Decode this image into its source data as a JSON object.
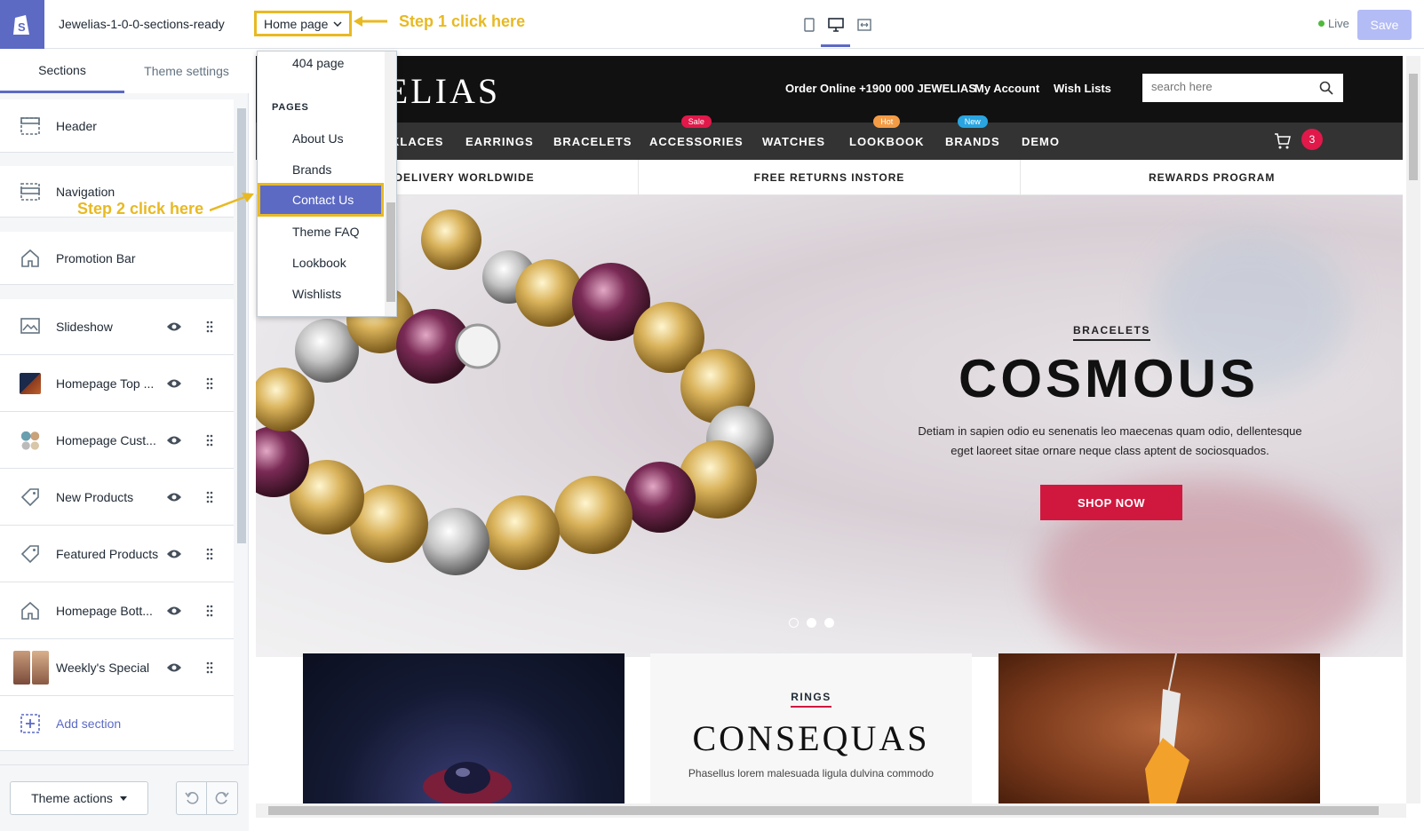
{
  "topbar": {
    "theme_name": "Jewelias-1-0-0-sections-ready",
    "page_select": "Home page",
    "step1": "Step 1 click here",
    "live": "Live",
    "save": "Save"
  },
  "sidebar": {
    "tabs": [
      "Sections",
      "Theme settings"
    ],
    "sections": [
      {
        "label": "Header"
      },
      {
        "label": "Navigation"
      },
      {
        "label": "Promotion Bar"
      },
      {
        "label": "Slideshow"
      },
      {
        "label": "Homepage Top ..."
      },
      {
        "label": "Homepage Cust..."
      },
      {
        "label": "New Products"
      },
      {
        "label": "Featured Products"
      },
      {
        "label": "Homepage Bott..."
      },
      {
        "label": "Weekly's Special"
      }
    ],
    "add_section": "Add section",
    "step2": "Step 2 click here",
    "theme_actions": "Theme actions"
  },
  "dropdown": {
    "items_top": [
      "404 page"
    ],
    "group": "PAGES",
    "items": [
      "About Us",
      "Brands",
      "Contact Us",
      "Theme FAQ",
      "Lookbook",
      "Wishlists"
    ],
    "selected": "Contact Us"
  },
  "store": {
    "logo": "JEWELIAS",
    "order_online": "Order Online +1900 000 JEWELIAS",
    "my_account": "My Account",
    "wish_lists": "Wish Lists",
    "search_placeholder": "search here",
    "nav": [
      "NECKLACES",
      "EARRINGS",
      "BRACELETS",
      "ACCESSORIES",
      "WATCHES",
      "LOOKBOOK",
      "BRANDS",
      "DEMO"
    ],
    "nav_visible_first": "KLACES",
    "badges": {
      "sale": "Sale",
      "hot": "Hot",
      "new": "New"
    },
    "cart_count": "3",
    "promo": [
      "FREE DELIVERY WORLDWIDE",
      "FREE RETURNS INSTORE",
      "REWARDS PROGRAM"
    ],
    "hero": {
      "category": "BRACELETS",
      "title": "COSMOUS",
      "text": "Detiam in sapien odio eu senenatis leo maecenas quam odio, dellentesque eget laoreet sitae ornare neque class aptent de sociosquados.",
      "button": "SHOP NOW"
    },
    "banner2": {
      "category": "RINGS",
      "title": "CONSEQUAS",
      "text": "Phasellus lorem malesuada ligula dulvina commodo"
    }
  },
  "colors": {
    "accent": "#5c6ac4",
    "step_highlight": "#e8b923",
    "hero_button": "#d0183f"
  }
}
